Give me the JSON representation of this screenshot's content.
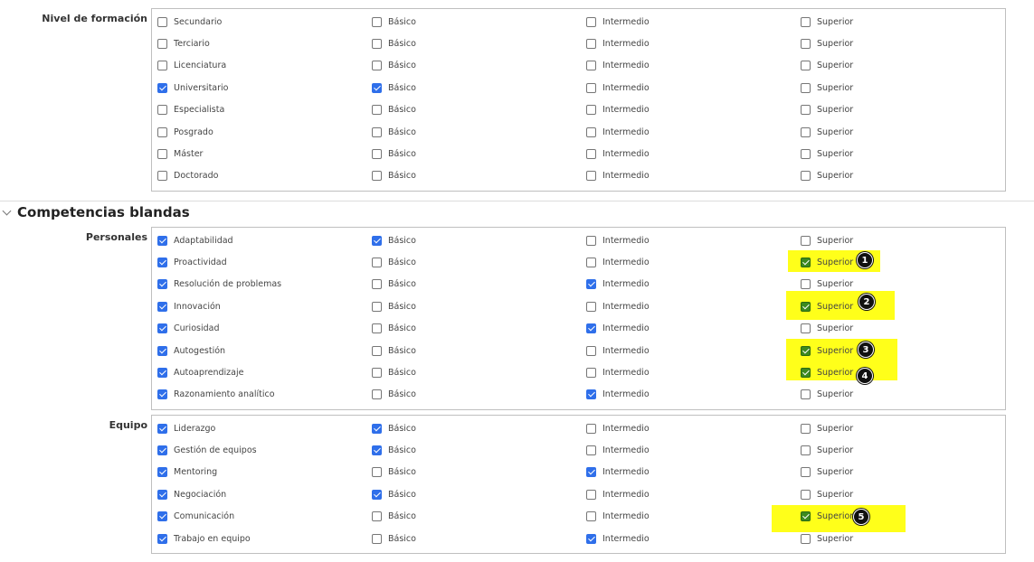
{
  "formacion": {
    "label": "Nivel de formación",
    "rows": [
      {
        "name": "Secundario",
        "checked": [
          false,
          false,
          false,
          false
        ]
      },
      {
        "name": "Terciario",
        "checked": [
          false,
          false,
          false,
          false
        ]
      },
      {
        "name": "Licenciatura",
        "checked": [
          false,
          false,
          false,
          false
        ]
      },
      {
        "name": "Universitario",
        "checked": [
          true,
          true,
          false,
          false
        ]
      },
      {
        "name": "Especialista",
        "checked": [
          false,
          false,
          false,
          false
        ]
      },
      {
        "name": "Posgrado",
        "checked": [
          false,
          false,
          false,
          false
        ]
      },
      {
        "name": "Máster",
        "checked": [
          false,
          false,
          false,
          false
        ]
      },
      {
        "name": "Doctorado",
        "checked": [
          false,
          false,
          false,
          false
        ]
      }
    ]
  },
  "levels": [
    "Básico",
    "Intermedio",
    "Superior"
  ],
  "section_title": "Competencias blandas",
  "personales": {
    "label": "Personales",
    "rows": [
      {
        "name": "Adaptabilidad",
        "checked": [
          true,
          true,
          false,
          false
        ]
      },
      {
        "name": "Proactividad",
        "checked": [
          true,
          false,
          false,
          true
        ]
      },
      {
        "name": "Resolución de problemas",
        "checked": [
          true,
          false,
          true,
          false
        ]
      },
      {
        "name": "Innovación",
        "checked": [
          true,
          false,
          false,
          true
        ]
      },
      {
        "name": "Curiosidad",
        "checked": [
          true,
          false,
          true,
          false
        ]
      },
      {
        "name": "Autogestión",
        "checked": [
          true,
          false,
          false,
          true
        ]
      },
      {
        "name": "Autoaprendizaje",
        "checked": [
          true,
          false,
          false,
          true
        ]
      },
      {
        "name": "Razonamiento analítico",
        "checked": [
          true,
          false,
          true,
          false
        ]
      }
    ]
  },
  "equipo": {
    "label": "Equipo",
    "rows": [
      {
        "name": "Liderazgo",
        "checked": [
          true,
          true,
          false,
          false
        ]
      },
      {
        "name": "Gestión de equipos",
        "checked": [
          true,
          true,
          false,
          false
        ]
      },
      {
        "name": "Mentoring",
        "checked": [
          true,
          false,
          true,
          false
        ]
      },
      {
        "name": "Negociación",
        "checked": [
          true,
          true,
          false,
          false
        ]
      },
      {
        "name": "Comunicación",
        "checked": [
          true,
          false,
          false,
          true
        ]
      },
      {
        "name": "Trabajo en equipo",
        "checked": [
          true,
          false,
          true,
          false
        ]
      }
    ]
  },
  "annotations": [
    "1",
    "2",
    "3",
    "4",
    "5"
  ],
  "colors": {
    "checkbox_blue": "#2f6fea",
    "highlight": "#ffff1a",
    "superior_green": "#3c8a1f"
  }
}
